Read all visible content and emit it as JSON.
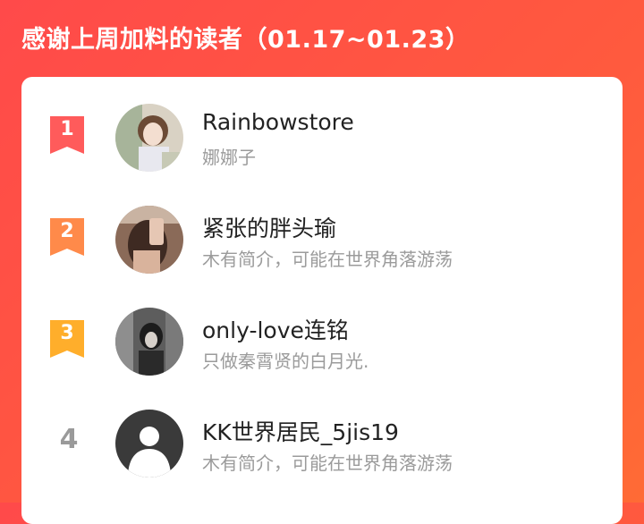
{
  "header": {
    "title": "感谢上周加料的读者（01.17~01.23）"
  },
  "readers": [
    {
      "rank": "1",
      "name": "Rainbowstore",
      "desc": "娜娜子",
      "badge_color": "#ff5b5b"
    },
    {
      "rank": "2",
      "name": "紧张的胖头瑜",
      "desc": "木有简介，可能在世界角落游荡",
      "badge_color": "#ff8a4a"
    },
    {
      "rank": "3",
      "name": "only-love连铭",
      "desc": "只做秦霄贤的白月光.",
      "badge_color": "#ffae2b"
    },
    {
      "rank": "4",
      "name": "KK世界居民_5jis19",
      "desc": "木有简介，可能在世界角落游荡"
    }
  ]
}
